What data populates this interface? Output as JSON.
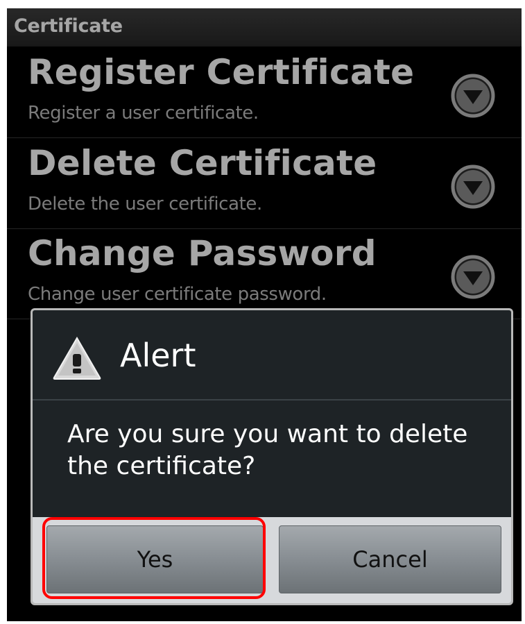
{
  "app": {
    "title": "Certificate"
  },
  "preferences": [
    {
      "title": "Register Certificate",
      "summary": "Register a user certificate.",
      "icon": "chevron-down-circle-icon"
    },
    {
      "title": "Delete Certificate",
      "summary": "Delete the user certificate.",
      "icon": "chevron-down-circle-icon"
    },
    {
      "title": "Change Password",
      "summary": "Change user certificate password.",
      "icon": "chevron-down-circle-icon"
    }
  ],
  "dialog": {
    "icon": "warning-icon",
    "title": "Alert",
    "message": "Are you sure you want to delete the certificate?",
    "buttons": {
      "yes": "Yes",
      "cancel": "Cancel"
    }
  },
  "colors": {
    "background": "#000000",
    "dialog_background": "#1e2326",
    "highlight": "#ff0000"
  }
}
